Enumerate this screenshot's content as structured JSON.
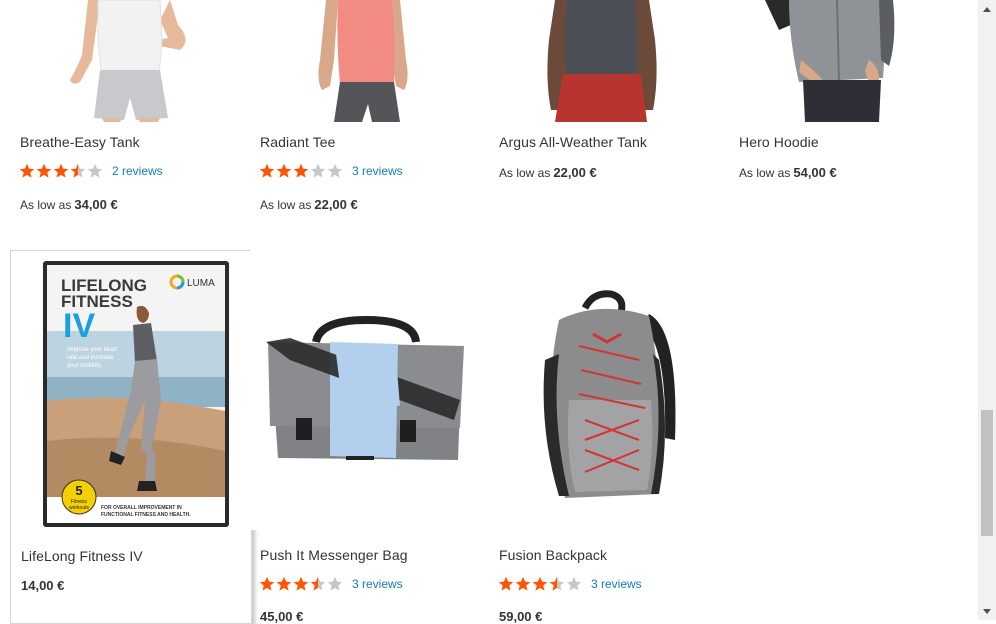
{
  "products": [
    {
      "name": "Breathe-Easy Tank",
      "rating_stars": 3.5,
      "reviews": "2 reviews",
      "price_label": "As low as",
      "price": "34,00 €"
    },
    {
      "name": "Radiant Tee",
      "rating_stars": 3,
      "reviews": "3 reviews",
      "price_label": "As low as",
      "price": "22,00 €"
    },
    {
      "name": "Argus All-Weather Tank",
      "price_label": "As low as",
      "price": "22,00 €"
    },
    {
      "name": "Hero Hoodie",
      "price_label": "As low as",
      "price": "54,00 €"
    },
    {
      "name": "LifeLong Fitness IV",
      "price": "14,00 €"
    },
    {
      "name": "Push It Messenger Bag",
      "rating_stars": 3.5,
      "reviews": "3 reviews",
      "price": "45,00 €"
    },
    {
      "name": "Fusion Backpack",
      "rating_stars": 3.5,
      "reviews": "3 reviews",
      "price": "59,00 €"
    }
  ],
  "dvd": {
    "title_line1": "LIFELONG",
    "title_line2": "FITNESS",
    "title_line3": "IV",
    "brand": "LUMA",
    "tagline1": "Improve your heart",
    "tagline2": "rate and increase",
    "tagline3": "your mobility.",
    "badge_number": "5",
    "badge_text1": "Fitness",
    "badge_text2": "workouts",
    "footer1": "FOR OVERALL IMPROVEMENT IN",
    "footer2": "FUNCTIONAL FITNESS AND HEALTH."
  },
  "colors": {
    "star_on": "#ff5501",
    "star_off": "#c7c7c7",
    "link": "#1979c3",
    "text": "#333333"
  },
  "icons": {
    "scroll_up": "triangle-up-icon",
    "scroll_down": "triangle-down-icon",
    "star": "star-icon"
  }
}
